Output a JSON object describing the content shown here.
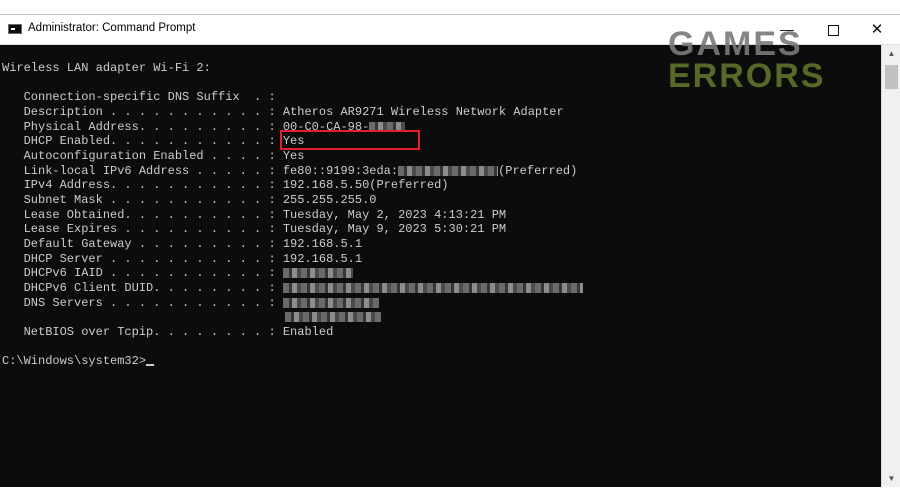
{
  "window": {
    "title": "Administrator: Command Prompt",
    "controls": {
      "minimize": "—",
      "close": "✕"
    }
  },
  "watermark": {
    "line1": "GAMES",
    "line2": "ERRORS"
  },
  "console": {
    "header": "Wireless LAN adapter Wi-Fi 2:",
    "rows": [
      {
        "label": "   Connection-specific DNS Suffix  . :",
        "value": ""
      },
      {
        "label": "   Description . . . . . . . . . . . :",
        "value": "Atheros AR9271 Wireless Network Adapter"
      },
      {
        "label": "   Physical Address. . . . . . . . . :",
        "value": "00-C0-CA-98-"
      },
      {
        "label": "   DHCP Enabled. . . . . . . . . . . :",
        "value": "Yes"
      },
      {
        "label": "   Autoconfiguration Enabled . . . . :",
        "value": "Yes"
      },
      {
        "label": "   Link-local IPv6 Address . . . . . :",
        "value": "fe80::9199:3eda:",
        "suffix": "(Preferred)"
      },
      {
        "label": "   IPv4 Address. . . . . . . . . . . :",
        "value": "192.168.5.50(Preferred)"
      },
      {
        "label": "   Subnet Mask . . . . . . . . . . . :",
        "value": "255.255.255.0"
      },
      {
        "label": "   Lease Obtained. . . . . . . . . . :",
        "value": "Tuesday, May 2, 2023 4:13:21 PM"
      },
      {
        "label": "   Lease Expires . . . . . . . . . . :",
        "value": "Tuesday, May 9, 2023 5:30:21 PM"
      },
      {
        "label": "   Default Gateway . . . . . . . . . :",
        "value": "192.168.5.1"
      },
      {
        "label": "   DHCP Server . . . . . . . . . . . :",
        "value": "192.168.5.1"
      },
      {
        "label": "   DHCPv6 IAID . . . . . . . . . . . :",
        "value": ""
      },
      {
        "label": "   DHCPv6 Client DUID. . . . . . . . :",
        "value": ""
      },
      {
        "label": "   DNS Servers . . . . . . . . . . . :",
        "value": ""
      },
      {
        "label": "   NetBIOS over Tcpip. . . . . . . . :",
        "value": "Enabled"
      }
    ],
    "prompt": "C:\\Windows\\system32>"
  },
  "scrollbar": {
    "up_arrow": "▲",
    "down_arrow": "▼"
  },
  "colors": {
    "console_bg": "#0c0c0c",
    "console_fg": "#cccccc",
    "highlight": "#e0202a",
    "watermark_green": "#5a6e2a"
  }
}
